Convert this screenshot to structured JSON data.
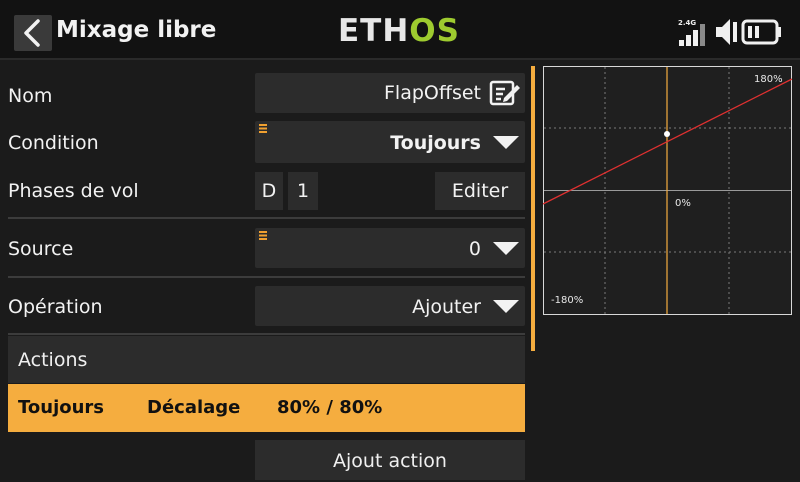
{
  "header": {
    "title": "Mixage libre",
    "logo_main": "ETH",
    "logo_accent": "OS",
    "rf_band": "2.4G"
  },
  "fields": {
    "name": {
      "label": "Nom",
      "value": "FlapOffset"
    },
    "condition": {
      "label": "Condition",
      "value": "Toujours"
    },
    "flight_modes": {
      "label": "Phases de vol",
      "chips": [
        "D",
        "1"
      ],
      "edit_label": "Editer"
    },
    "source": {
      "label": "Source",
      "value": "0"
    },
    "operation": {
      "label": "Opération",
      "value": "Ajouter"
    }
  },
  "actions": {
    "header": "Actions",
    "rows": [
      {
        "condition": "Toujours",
        "type": "Décalage",
        "value": "80% / 80%"
      }
    ],
    "add_label": "Ajout action"
  },
  "graph": {
    "top_right_label": "180%",
    "center_label": "0%",
    "bottom_left_label": "-180%",
    "curve_color": "#e03030",
    "cursor_color": "#f5ad3f"
  },
  "colors": {
    "accent": "#f5ad3f",
    "logo_green": "#9ecb2f",
    "field_bg": "#2c2c2c"
  }
}
